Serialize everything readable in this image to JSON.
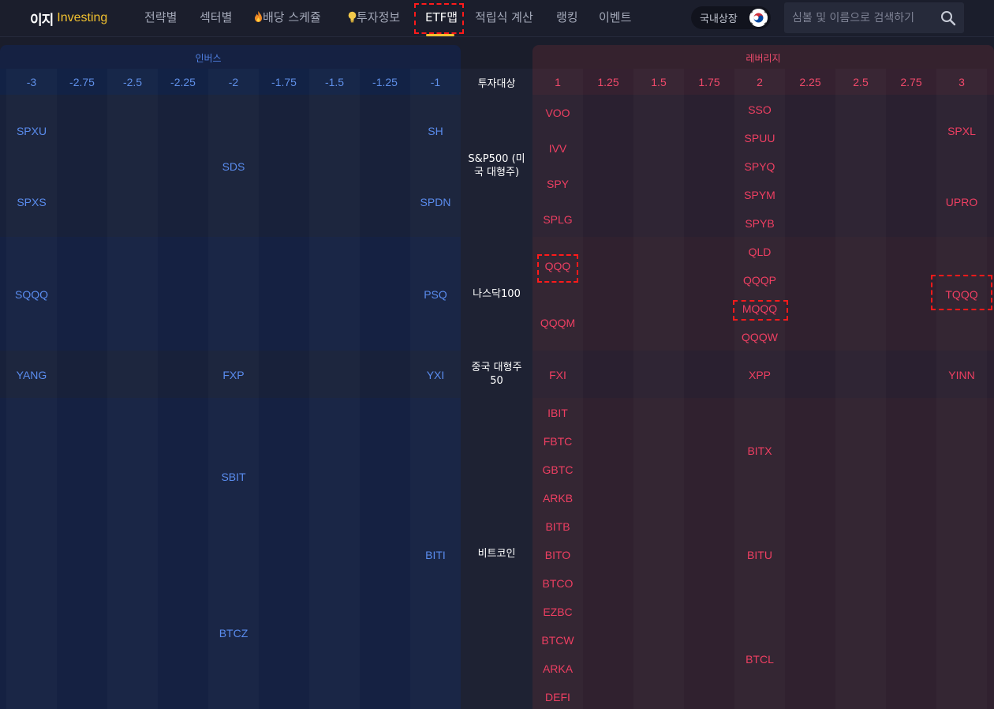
{
  "nav": {
    "logo_main": "이지",
    "logo_sub": "Investing",
    "items": [
      "전략별",
      "섹터별",
      "배당 스케쥴",
      "투자정보",
      "ETF맵",
      "적립식 계산",
      "랭킹",
      "이벤트"
    ],
    "active": "ETF맵",
    "market_toggle": "국내상장",
    "search_placeholder": "심볼 및 이름으로 검색하기"
  },
  "colors": {
    "inverse": "#5a8cee",
    "leverage": "#ef3f62",
    "accent": "#f1c12f",
    "highlight": "#ff1a1a"
  },
  "table": {
    "inverse_label": "인버스",
    "leverage_label": "레버리지",
    "center_header": "투자대상",
    "inverse_ticks": [
      "-3",
      "-2.75",
      "-2.5",
      "-2.25",
      "-2",
      "-1.75",
      "-1.5",
      "-1.25",
      "-1"
    ],
    "leverage_ticks": [
      "1",
      "1.25",
      "1.5",
      "1.75",
      "2",
      "2.25",
      "2.5",
      "2.75",
      "3"
    ],
    "rows": [
      {
        "category": "S&P500 (미국 대형주)",
        "inverse": {
          "-3": [
            "SPXU",
            "SPXS"
          ],
          "-2": [
            "SDS"
          ],
          "-1": [
            "SH",
            "SPDN"
          ]
        },
        "leverage": {
          "1": [
            "VOO",
            "IVV",
            "SPY",
            "SPLG"
          ],
          "2": [
            "SSO",
            "SPUU",
            "SPYQ",
            "SPYM",
            "SPYB"
          ],
          "3": [
            "SPXL",
            "UPRO"
          ]
        }
      },
      {
        "category": "나스닥100",
        "inverse": {
          "-3": [
            "SQQQ"
          ],
          "-1": [
            "PSQ"
          ]
        },
        "leverage": {
          "1": [
            "QQQ",
            "QQQM"
          ],
          "2": [
            "QLD",
            "QQQP",
            "MQQQ",
            "QQQW"
          ],
          "3": [
            "TQQQ"
          ]
        }
      },
      {
        "category": "중국 대형주 50",
        "inverse": {
          "-3": [
            "YANG"
          ],
          "-2": [
            "FXP"
          ],
          "-1": [
            "YXI"
          ]
        },
        "leverage": {
          "1": [
            "FXI"
          ],
          "2": [
            "XPP"
          ],
          "3": [
            "YINN"
          ]
        }
      },
      {
        "category": "비트코인",
        "inverse": {
          "-2": [
            "SBIT",
            "BTCZ"
          ],
          "-1": [
            "BITI"
          ]
        },
        "leverage": {
          "1": [
            "IBIT",
            "FBTC",
            "GBTC",
            "ARKB",
            "BITB",
            "BITO",
            "BTCO",
            "EZBC",
            "BTCW",
            "ARKA",
            "DEFI"
          ],
          "2": [
            "BITX",
            "BITU",
            "BTCL"
          ]
        }
      }
    ],
    "highlighted": [
      "ETF맵",
      "QQQ",
      "MQQQ",
      "TQQQ"
    ]
  }
}
